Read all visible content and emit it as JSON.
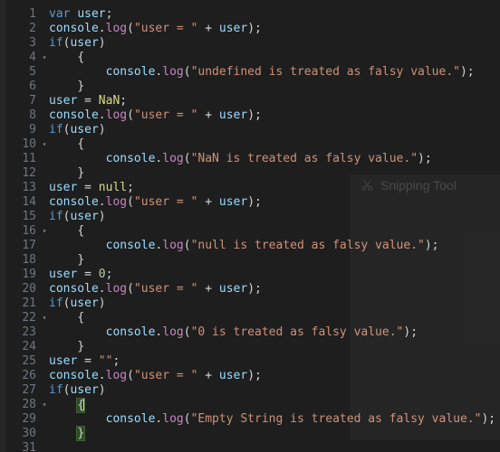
{
  "editor": {
    "language": "javascript",
    "theme": "dark-plus",
    "background": "#1e1e1e",
    "gutter_color": "#6e7681",
    "colors": {
      "keyword": "#569cd6",
      "identifier": "#9cdcfe",
      "function": "#c586c0",
      "string": "#ce9178",
      "number": "#b5cea8",
      "constant": "#dcdc8a",
      "punctuation": "#d4d4d4",
      "bracket_match_bg": "#2f4a26",
      "caret": "#d4d4d4"
    },
    "fold_marker": "▾",
    "lines": [
      {
        "n": "1",
        "fold": "",
        "indent": 0,
        "tokens": [
          {
            "t": "var",
            "c": "kw"
          },
          {
            "t": " ",
            "c": "punc"
          },
          {
            "t": "user",
            "c": "var"
          },
          {
            "t": ";",
            "c": "punc"
          }
        ]
      },
      {
        "n": "2",
        "fold": "",
        "indent": 0,
        "tokens": [
          {
            "t": "console",
            "c": "var"
          },
          {
            "t": ".",
            "c": "punc"
          },
          {
            "t": "log",
            "c": "fn"
          },
          {
            "t": "(",
            "c": "punc"
          },
          {
            "t": "\"user = \"",
            "c": "str"
          },
          {
            "t": " + ",
            "c": "punc"
          },
          {
            "t": "user",
            "c": "var"
          },
          {
            "t": ");",
            "c": "punc"
          }
        ]
      },
      {
        "n": "3",
        "fold": "",
        "indent": 0,
        "tokens": [
          {
            "t": "if",
            "c": "kw"
          },
          {
            "t": "(",
            "c": "punc"
          },
          {
            "t": "user",
            "c": "var"
          },
          {
            "t": ")",
            "c": "punc"
          }
        ]
      },
      {
        "n": "4",
        "fold": "▾",
        "indent": 4,
        "tokens": [
          {
            "t": "{",
            "c": "punc"
          }
        ]
      },
      {
        "n": "5",
        "fold": "",
        "indent": 8,
        "tokens": [
          {
            "t": "console",
            "c": "var"
          },
          {
            "t": ".",
            "c": "punc"
          },
          {
            "t": "log",
            "c": "fn"
          },
          {
            "t": "(",
            "c": "punc"
          },
          {
            "t": "\"undefined is treated as falsy value.\"",
            "c": "str"
          },
          {
            "t": ");",
            "c": "punc"
          }
        ]
      },
      {
        "n": "6",
        "fold": "",
        "indent": 4,
        "tokens": [
          {
            "t": "}",
            "c": "punc"
          }
        ]
      },
      {
        "n": "7",
        "fold": "",
        "indent": 0,
        "tokens": [
          {
            "t": "user",
            "c": "var"
          },
          {
            "t": " = ",
            "c": "punc"
          },
          {
            "t": "NaN",
            "c": "const"
          },
          {
            "t": ";",
            "c": "punc"
          }
        ]
      },
      {
        "n": "8",
        "fold": "",
        "indent": 0,
        "tokens": [
          {
            "t": "console",
            "c": "var"
          },
          {
            "t": ".",
            "c": "punc"
          },
          {
            "t": "log",
            "c": "fn"
          },
          {
            "t": "(",
            "c": "punc"
          },
          {
            "t": "\"user = \"",
            "c": "str"
          },
          {
            "t": " + ",
            "c": "punc"
          },
          {
            "t": "user",
            "c": "var"
          },
          {
            "t": ");",
            "c": "punc"
          }
        ]
      },
      {
        "n": "9",
        "fold": "",
        "indent": 0,
        "tokens": [
          {
            "t": "if",
            "c": "kw"
          },
          {
            "t": "(",
            "c": "punc"
          },
          {
            "t": "user",
            "c": "var"
          },
          {
            "t": ")",
            "c": "punc"
          }
        ]
      },
      {
        "n": "10",
        "fold": "▾",
        "indent": 4,
        "tokens": [
          {
            "t": "{",
            "c": "punc"
          }
        ]
      },
      {
        "n": "11",
        "fold": "",
        "indent": 8,
        "tokens": [
          {
            "t": "console",
            "c": "var"
          },
          {
            "t": ".",
            "c": "punc"
          },
          {
            "t": "log",
            "c": "fn"
          },
          {
            "t": "(",
            "c": "punc"
          },
          {
            "t": "\"NaN is treated as falsy value.\"",
            "c": "str"
          },
          {
            "t": ");",
            "c": "punc"
          }
        ]
      },
      {
        "n": "12",
        "fold": "",
        "indent": 4,
        "tokens": [
          {
            "t": "}",
            "c": "punc"
          }
        ]
      },
      {
        "n": "13",
        "fold": "",
        "indent": 0,
        "tokens": [
          {
            "t": "user",
            "c": "var"
          },
          {
            "t": " = ",
            "c": "punc"
          },
          {
            "t": "null",
            "c": "const"
          },
          {
            "t": ";",
            "c": "punc"
          }
        ]
      },
      {
        "n": "14",
        "fold": "",
        "indent": 0,
        "tokens": [
          {
            "t": "console",
            "c": "var"
          },
          {
            "t": ".",
            "c": "punc"
          },
          {
            "t": "log",
            "c": "fn"
          },
          {
            "t": "(",
            "c": "punc"
          },
          {
            "t": "\"user = \"",
            "c": "str"
          },
          {
            "t": " + ",
            "c": "punc"
          },
          {
            "t": "user",
            "c": "var"
          },
          {
            "t": ");",
            "c": "punc"
          }
        ]
      },
      {
        "n": "15",
        "fold": "",
        "indent": 0,
        "tokens": [
          {
            "t": "if",
            "c": "kw"
          },
          {
            "t": "(",
            "c": "punc"
          },
          {
            "t": "user",
            "c": "var"
          },
          {
            "t": ")",
            "c": "punc"
          }
        ]
      },
      {
        "n": "16",
        "fold": "▾",
        "indent": 4,
        "tokens": [
          {
            "t": "{",
            "c": "punc"
          }
        ]
      },
      {
        "n": "17",
        "fold": "",
        "indent": 8,
        "tokens": [
          {
            "t": "console",
            "c": "var"
          },
          {
            "t": ".",
            "c": "punc"
          },
          {
            "t": "log",
            "c": "fn"
          },
          {
            "t": "(",
            "c": "punc"
          },
          {
            "t": "\"null is treated as falsy value.\"",
            "c": "str"
          },
          {
            "t": ");",
            "c": "punc"
          }
        ]
      },
      {
        "n": "18",
        "fold": "",
        "indent": 4,
        "tokens": [
          {
            "t": "}",
            "c": "punc"
          }
        ]
      },
      {
        "n": "19",
        "fold": "",
        "indent": 0,
        "tokens": [
          {
            "t": "user",
            "c": "var"
          },
          {
            "t": " = ",
            "c": "punc"
          },
          {
            "t": "0",
            "c": "num"
          },
          {
            "t": ";",
            "c": "punc"
          }
        ]
      },
      {
        "n": "20",
        "fold": "",
        "indent": 0,
        "tokens": [
          {
            "t": "console",
            "c": "var"
          },
          {
            "t": ".",
            "c": "punc"
          },
          {
            "t": "log",
            "c": "fn"
          },
          {
            "t": "(",
            "c": "punc"
          },
          {
            "t": "\"user = \"",
            "c": "str"
          },
          {
            "t": " + ",
            "c": "punc"
          },
          {
            "t": "user",
            "c": "var"
          },
          {
            "t": ");",
            "c": "punc"
          }
        ]
      },
      {
        "n": "21",
        "fold": "",
        "indent": 0,
        "tokens": [
          {
            "t": "if",
            "c": "kw"
          },
          {
            "t": "(",
            "c": "punc"
          },
          {
            "t": "user",
            "c": "var"
          },
          {
            "t": ")",
            "c": "punc"
          }
        ]
      },
      {
        "n": "22",
        "fold": "▾",
        "indent": 4,
        "tokens": [
          {
            "t": "{",
            "c": "punc"
          }
        ]
      },
      {
        "n": "23",
        "fold": "",
        "indent": 8,
        "tokens": [
          {
            "t": "console",
            "c": "var"
          },
          {
            "t": ".",
            "c": "punc"
          },
          {
            "t": "log",
            "c": "fn"
          },
          {
            "t": "(",
            "c": "punc"
          },
          {
            "t": "\"0 is treated as falsy value.\"",
            "c": "str"
          },
          {
            "t": ");",
            "c": "punc"
          }
        ]
      },
      {
        "n": "24",
        "fold": "",
        "indent": 4,
        "tokens": [
          {
            "t": "}",
            "c": "punc"
          }
        ]
      },
      {
        "n": "25",
        "fold": "",
        "indent": 0,
        "tokens": [
          {
            "t": "user",
            "c": "var"
          },
          {
            "t": " = ",
            "c": "punc"
          },
          {
            "t": "\"\"",
            "c": "str"
          },
          {
            "t": ";",
            "c": "punc"
          }
        ]
      },
      {
        "n": "26",
        "fold": "",
        "indent": 0,
        "tokens": [
          {
            "t": "console",
            "c": "var"
          },
          {
            "t": ".",
            "c": "punc"
          },
          {
            "t": "log",
            "c": "fn"
          },
          {
            "t": "(",
            "c": "punc"
          },
          {
            "t": "\"user = \"",
            "c": "str"
          },
          {
            "t": " + ",
            "c": "punc"
          },
          {
            "t": "user",
            "c": "var"
          },
          {
            "t": ");",
            "c": "punc"
          }
        ]
      },
      {
        "n": "27",
        "fold": "",
        "indent": 0,
        "tokens": [
          {
            "t": "if",
            "c": "kw"
          },
          {
            "t": "(",
            "c": "punc"
          },
          {
            "t": "user",
            "c": "var"
          },
          {
            "t": ")",
            "c": "punc"
          }
        ]
      },
      {
        "n": "28",
        "fold": "▾",
        "indent": 4,
        "tokens": [
          {
            "t": "{",
            "c": "punc",
            "hl": true,
            "caret": true
          }
        ]
      },
      {
        "n": "29",
        "fold": "",
        "indent": 8,
        "tokens": [
          {
            "t": "console",
            "c": "var"
          },
          {
            "t": ".",
            "c": "punc"
          },
          {
            "t": "log",
            "c": "fn"
          },
          {
            "t": "(",
            "c": "punc"
          },
          {
            "t": "\"Empty String is treated as falsy value.\"",
            "c": "str"
          },
          {
            "t": ");",
            "c": "punc"
          }
        ]
      },
      {
        "n": "30",
        "fold": "",
        "indent": 4,
        "tokens": [
          {
            "t": "}",
            "c": "punc",
            "hl": true
          }
        ]
      },
      {
        "n": "31",
        "fold": "",
        "indent": 0,
        "tokens": []
      }
    ]
  },
  "snipping_tool": {
    "label": "Snipping Tool",
    "icon": "snipping-tool-scissors-icon",
    "text_color": "#4a4a4a"
  }
}
